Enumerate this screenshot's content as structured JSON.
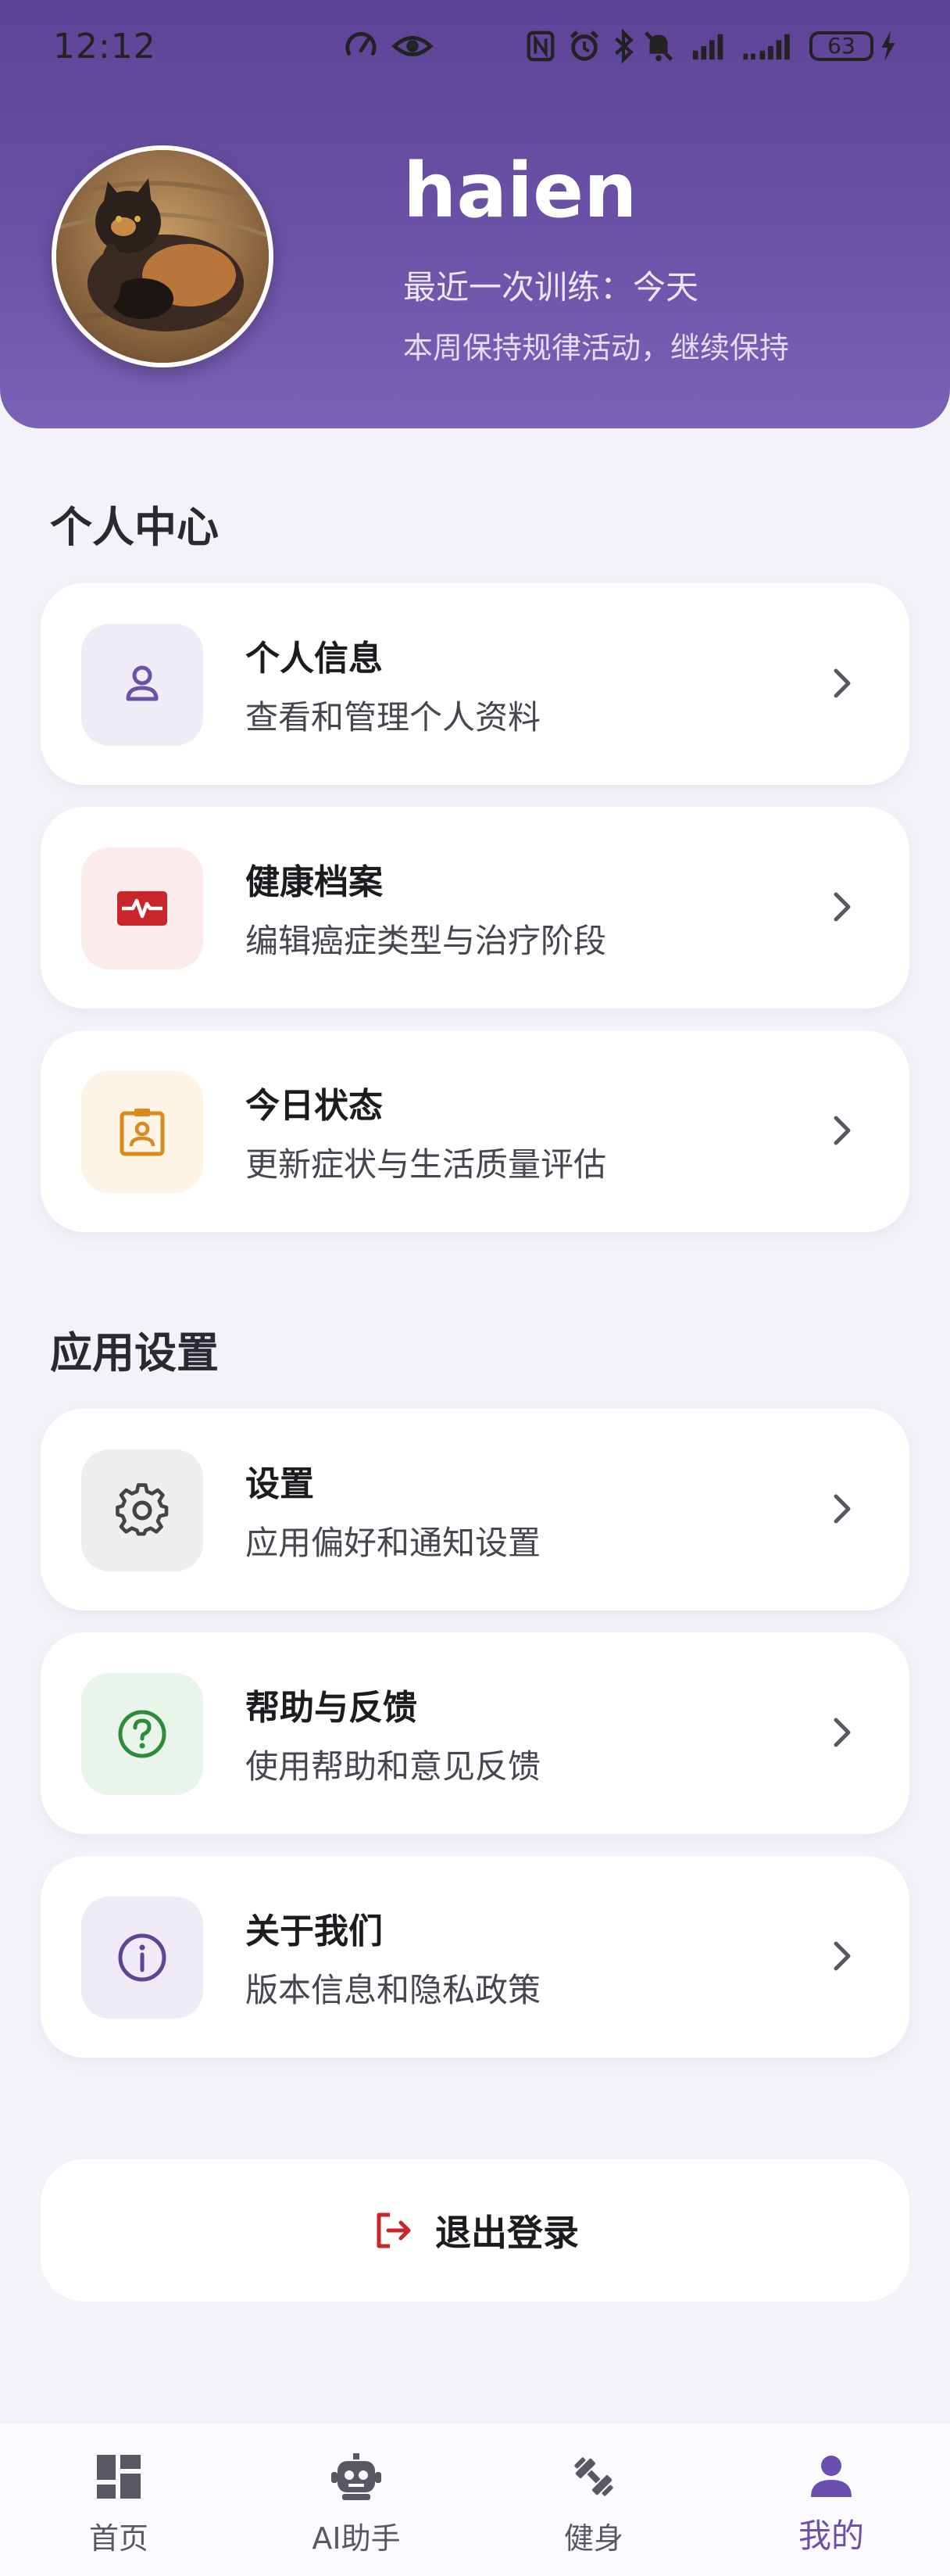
{
  "status_bar": {
    "time": "12:12",
    "battery": "63"
  },
  "profile": {
    "username": "haien",
    "last_training": "最近一次训练：今天",
    "weekly_note": "本周保持规律活动，继续保持"
  },
  "sections": {
    "personal": {
      "title": "个人中心",
      "items": [
        {
          "title": "个人信息",
          "subtitle": "查看和管理个人资料",
          "icon": "person-icon",
          "icon_bg": "#efecf8",
          "icon_color": "#6a52a6"
        },
        {
          "title": "健康档案",
          "subtitle": "编辑癌症类型与治疗阶段",
          "icon": "heart-monitor-icon",
          "icon_bg": "#fbeceb",
          "icon_color": "#c8262a"
        },
        {
          "title": "今日状态",
          "subtitle": "更新症状与生活质量评估",
          "icon": "badge-icon",
          "icon_bg": "#fdf4e6",
          "icon_color": "#d98a1c"
        }
      ]
    },
    "app_settings": {
      "title": "应用设置",
      "items": [
        {
          "title": "设置",
          "subtitle": "应用偏好和通知设置",
          "icon": "gear-icon",
          "icon_bg": "#eeeeef",
          "icon_color": "#444444"
        },
        {
          "title": "帮助与反馈",
          "subtitle": "使用帮助和意见反馈",
          "icon": "help-icon",
          "icon_bg": "#e9f4ea",
          "icon_color": "#2e8b3a"
        },
        {
          "title": "关于我们",
          "subtitle": "版本信息和隐私政策",
          "icon": "info-icon",
          "icon_bg": "#eeebf7",
          "icon_color": "#5d4496"
        }
      ]
    }
  },
  "logout": {
    "label": "退出登录",
    "icon": "logout-icon",
    "icon_color": "#c8262a"
  },
  "bottom_nav": {
    "items": [
      {
        "label": "首页",
        "icon": "dashboard-icon",
        "active": false
      },
      {
        "label": "AI助手",
        "icon": "robot-icon",
        "active": false
      },
      {
        "label": "健身",
        "icon": "dumbbell-icon",
        "active": false
      },
      {
        "label": "我的",
        "icon": "person-icon",
        "active": true
      }
    ],
    "active_color": "#6a4fb0",
    "inactive_color": "#5a5764"
  }
}
